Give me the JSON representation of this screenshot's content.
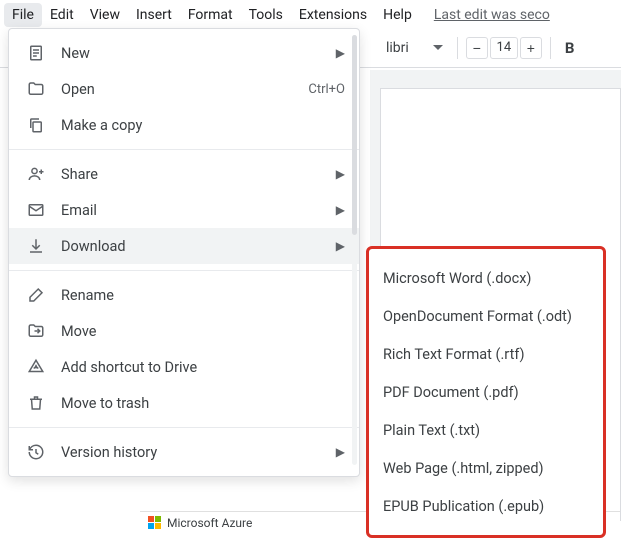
{
  "menubar": {
    "items": [
      "File",
      "Edit",
      "View",
      "Insert",
      "Format",
      "Tools",
      "Extensions",
      "Help"
    ],
    "last_edit": "Last edit was seco"
  },
  "toolbar": {
    "font_name": "libri",
    "font_size": "14"
  },
  "file_menu": {
    "new": "New",
    "open": "Open",
    "open_shortcut": "Ctrl+O",
    "make_copy": "Make a copy",
    "share": "Share",
    "email": "Email",
    "download": "Download",
    "rename": "Rename",
    "move": "Move",
    "add_shortcut": "Add shortcut to Drive",
    "move_trash": "Move to trash",
    "version_history": "Version history"
  },
  "download_submenu": {
    "items": [
      "Microsoft Word (.docx)",
      "OpenDocument Format (.odt)",
      "Rich Text Format (.rtf)",
      "PDF Document (.pdf)",
      "Plain Text (.txt)",
      "Web Page (.html, zipped)",
      "EPUB Publication (.epub)"
    ]
  },
  "taskbar": {
    "azure": "Microsoft Azure"
  }
}
